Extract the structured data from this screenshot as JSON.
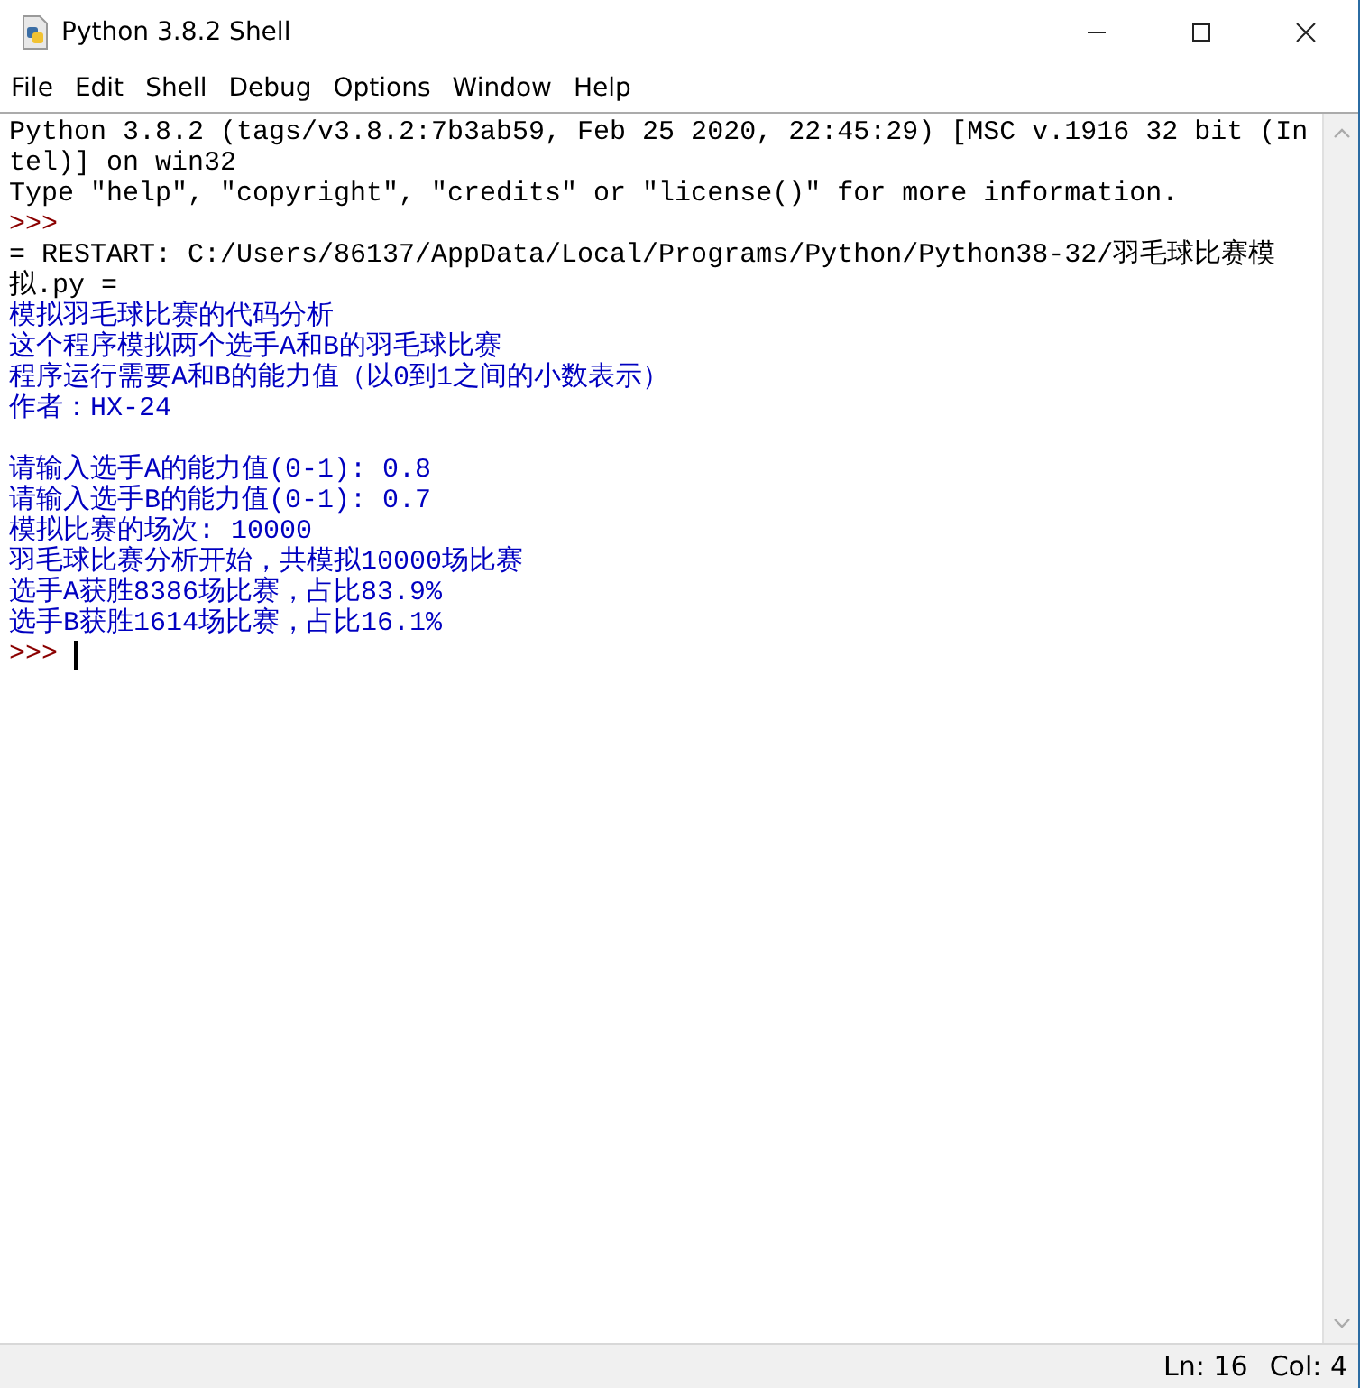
{
  "window": {
    "title": "Python 3.8.2 Shell"
  },
  "menu": [
    {
      "label": "File"
    },
    {
      "label": "Edit"
    },
    {
      "label": "Shell"
    },
    {
      "label": "Debug"
    },
    {
      "label": "Options"
    },
    {
      "label": "Window"
    },
    {
      "label": "Help"
    }
  ],
  "shell_lines": [
    {
      "kind": "output",
      "text": "Python 3.8.2 (tags/v3.8.2:7b3ab59, Feb 25 2020, 22:45:29) [MSC v.1916 32 bit (In"
    },
    {
      "kind": "output",
      "text": "tel)] on win32"
    },
    {
      "kind": "output",
      "text": "Type \"help\", \"copyright\", \"credits\" or \"license()\" for more information."
    },
    {
      "kind": "prompt",
      "text": ">>>",
      "cursor": false
    },
    {
      "kind": "output",
      "text": "= RESTART: C:/Users/86137/AppData/Local/Programs/Python/Python38-32/羽毛球比赛模"
    },
    {
      "kind": "output",
      "text": "拟.py ="
    },
    {
      "kind": "stdout",
      "text": "模拟羽毛球比赛的代码分析"
    },
    {
      "kind": "stdout",
      "text": "这个程序模拟两个选手A和B的羽毛球比赛"
    },
    {
      "kind": "stdout",
      "text": "程序运行需要A和B的能力值（以0到1之间的小数表示）"
    },
    {
      "kind": "stdout",
      "text": "作者：HX-24"
    },
    {
      "kind": "blank"
    },
    {
      "kind": "stdout",
      "text": "请输入选手A的能力值(0-1): 0.8"
    },
    {
      "kind": "stdout",
      "text": "请输入选手B的能力值(0-1): 0.7"
    },
    {
      "kind": "stdout",
      "text": "模拟比赛的场次: 10000"
    },
    {
      "kind": "stdout",
      "text": "羽毛球比赛分析开始，共模拟10000场比赛"
    },
    {
      "kind": "stdout",
      "text": "选手A获胜8386场比赛，占比83.9%"
    },
    {
      "kind": "stdout",
      "text": "选手B获胜1614场比赛，占比16.1%"
    },
    {
      "kind": "prompt",
      "text": ">>>",
      "cursor": true
    }
  ],
  "status_bar": {
    "line": "Ln: 16",
    "column": "Col: 4"
  }
}
